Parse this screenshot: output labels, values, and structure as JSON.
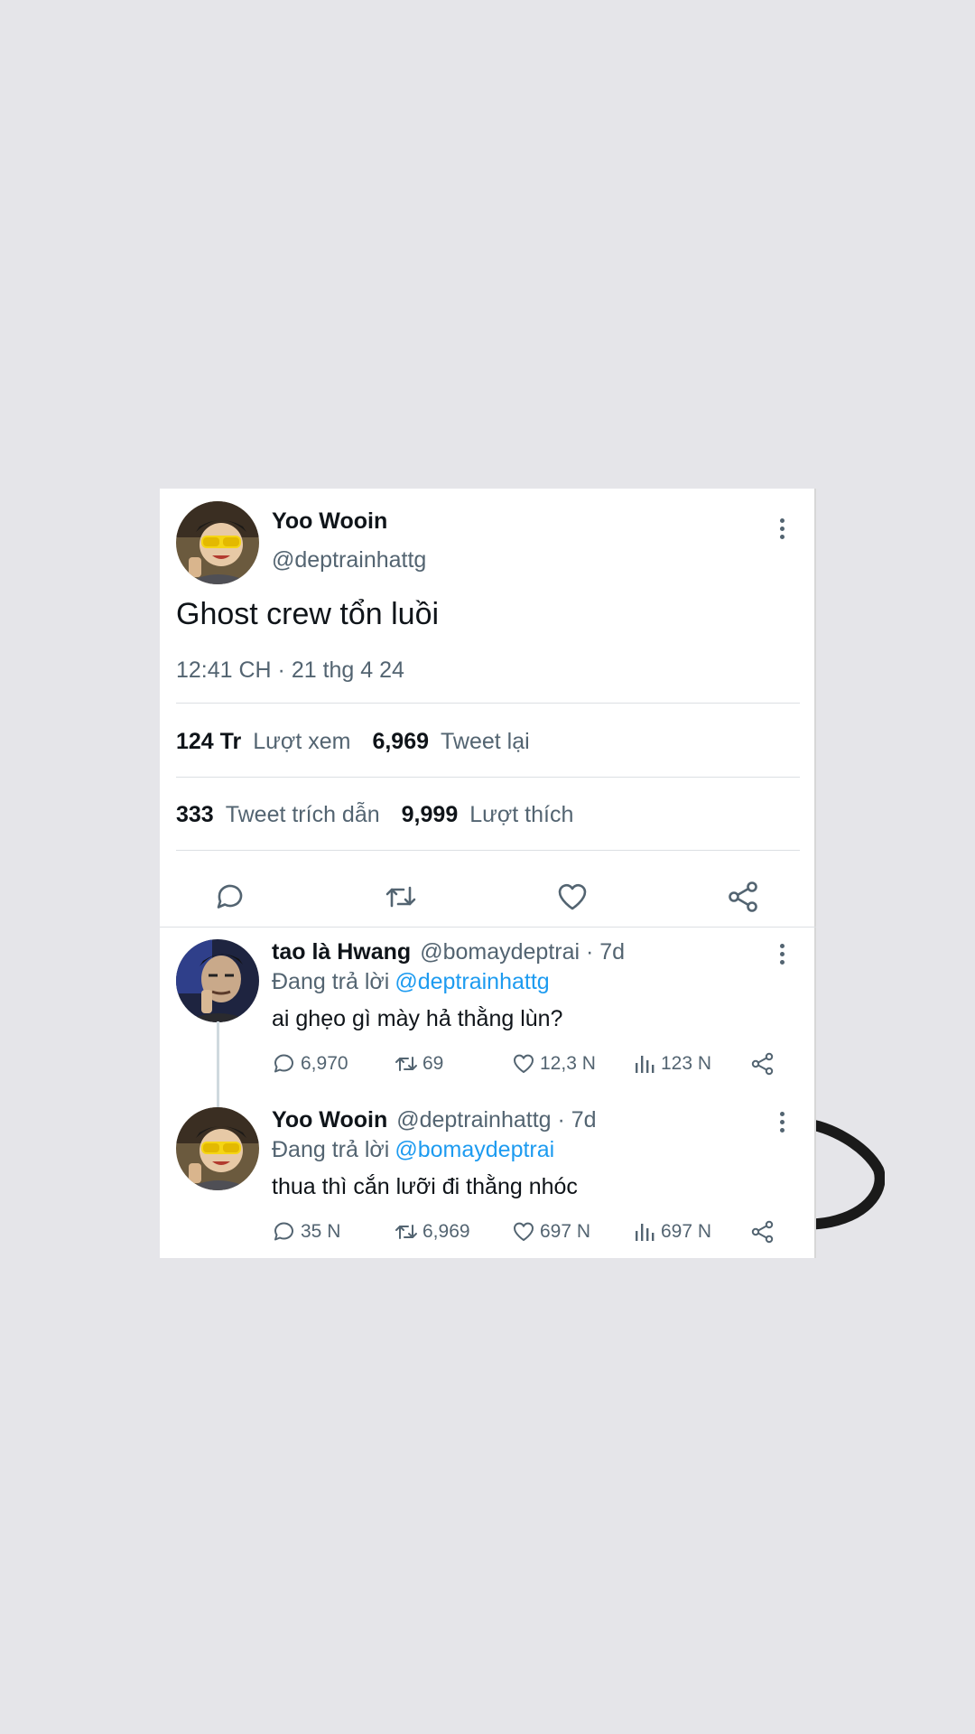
{
  "main_tweet": {
    "author_name": "Yoo Wooin",
    "handle": "@deptrainhattg",
    "text": "Ghost crew tổn luồi",
    "timestamp": "12:41 CH · 21 thg 4 24",
    "stats_row1": [
      {
        "value": "124 Tr",
        "label": "Lượt xem"
      },
      {
        "value": "6,969",
        "label": "Tweet lại"
      }
    ],
    "stats_row2": [
      {
        "value": "333",
        "label": "Tweet trích dẫn"
      },
      {
        "value": "9,999",
        "label": "Lượt thích"
      }
    ],
    "actions": [
      "reply-icon",
      "retweet-icon",
      "heart-icon",
      "share-icon"
    ]
  },
  "replies": [
    {
      "author_name": "tao là Hwang",
      "handle_time": "@bomaydeptrai · 7d",
      "replying_prefix": "Đang trả lời",
      "replying_to": "@deptrainhattg",
      "text": "ai ghẹo gì mày hả thằng lùn?",
      "counts": {
        "replies": "6,970",
        "retweets": "69",
        "likes": "12,3 N",
        "views": "123 N"
      }
    },
    {
      "author_name": "Yoo Wooin",
      "handle_time": "@deptrainhattg · 7d",
      "replying_prefix": "Đang trả lời",
      "replying_to": "@bomaydeptrai",
      "text": "thua thì cắn lưỡi đi thằng nhóc",
      "counts": {
        "replies": "35 N",
        "retweets": "6,969",
        "likes": "697 N",
        "views": "697 N"
      }
    }
  ],
  "colors": {
    "background": "#e5e5e9",
    "card": "#ffffff",
    "text_primary": "#0f1419",
    "text_secondary": "#536471",
    "link": "#1d9bf0"
  }
}
